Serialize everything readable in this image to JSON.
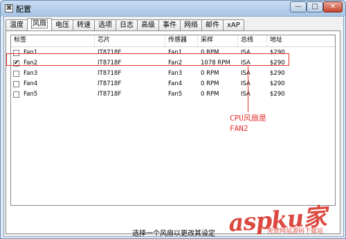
{
  "window": {
    "title": "配置",
    "minimize_glyph": "—",
    "maximize_glyph": "□",
    "close_glyph": "✕"
  },
  "tabs": [
    "温度",
    "风扇",
    "电压",
    "转速",
    "选项",
    "日志",
    "高级",
    "事件",
    "网络",
    "邮件",
    "xAP"
  ],
  "active_tab": "风扇",
  "table": {
    "headers": [
      "标签",
      "芯片",
      "传感器",
      "采样",
      "总线",
      "地址"
    ],
    "rows": [
      {
        "checked": false,
        "label": "Fan1",
        "chip": "IT8718F",
        "sensor": "Fan1",
        "sample": "0 RPM",
        "bus": "ISA",
        "address": "$290"
      },
      {
        "checked": true,
        "label": "Fan2",
        "chip": "IT8718F",
        "sensor": "Fan2",
        "sample": "1078 RPM",
        "bus": "ISA",
        "address": "$290"
      },
      {
        "checked": false,
        "label": "Fan3",
        "chip": "IT8718F",
        "sensor": "Fan3",
        "sample": "0 RPM",
        "bus": "ISA",
        "address": "$290"
      },
      {
        "checked": false,
        "label": "Fan4",
        "chip": "IT8718F",
        "sensor": "Fan4",
        "sample": "0 RPM",
        "bus": "ISA",
        "address": "$290"
      },
      {
        "checked": false,
        "label": "Fan5",
        "chip": "IT8718F",
        "sensor": "Fan5",
        "sample": "0 RPM",
        "bus": "ISA",
        "address": "$290"
      }
    ]
  },
  "annotation": {
    "line1": "CPU风扇是",
    "line2": "FAN2",
    "color": "#e0302a"
  },
  "status_text": "选择一个风扇以更改其设定",
  "watermark": {
    "main": "aspku家",
    "sub": "免费网站源码下载站"
  }
}
